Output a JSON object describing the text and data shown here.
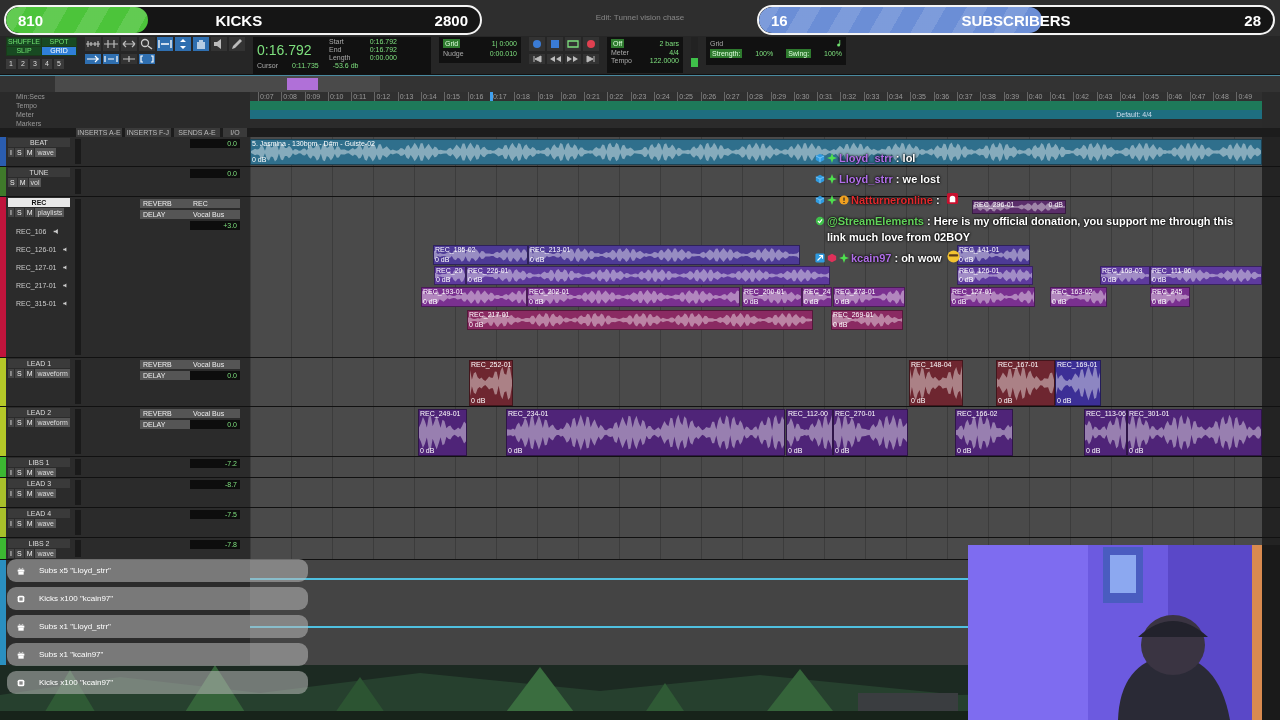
{
  "window": {
    "title": "Edit: Tunnel vision chase"
  },
  "toolbar": {
    "modes": [
      {
        "label": "SHUFFLE",
        "selected": false
      },
      {
        "label": "SPOT",
        "selected": false
      },
      {
        "label": "SLIP",
        "selected": false
      },
      {
        "label": "GRID",
        "selected": true
      }
    ],
    "zoom_presets": [
      "1",
      "2",
      "3",
      "4",
      "5"
    ],
    "counter": {
      "main": "0:16.792",
      "start_label": "Start",
      "start": "0:16.792",
      "end_label": "End",
      "end": "0:16.792",
      "length_label": "Length",
      "length": "0:00.000",
      "cursor_label": "Cursor",
      "cursor": "0:11.735",
      "cursor_value": "-53.6 db"
    },
    "grid": {
      "grid_label": "Grid",
      "grid_value": "1| 0:000",
      "nudge_label": "Nudge",
      "nudge_value": "0:00.010"
    },
    "count": {
      "count_off": "Off",
      "bars": "2 bars",
      "meter_label": "Meter",
      "meter": "4/4",
      "tempo_label": "Tempo",
      "tempo": "122.0000"
    },
    "midi": {
      "grid_label": "Grid",
      "strength_label": "Strength:",
      "strength": "100%",
      "swing_label": "Swing:",
      "swing": "100%"
    }
  },
  "ruler": {
    "rows": [
      "Min:Secs",
      "Tempo",
      "Meter",
      "Markers"
    ],
    "ticks": [
      "0:07",
      "0:08",
      "0:09",
      "0:10",
      "0:11",
      "0:12",
      "0:13",
      "0:14",
      "0:15",
      "0:16",
      "0:17",
      "0:18",
      "0:19",
      "0:20",
      "0:21",
      "0:22",
      "0:23",
      "0:24",
      "0:25",
      "0:26",
      "0:27",
      "0:28",
      "0:29",
      "0:30",
      "0:31",
      "0:32",
      "0:33",
      "0:34",
      "0:35",
      "0:36",
      "0:37",
      "0:38",
      "0:39",
      "0:40",
      "0:41",
      "0:42",
      "0:43",
      "0:44",
      "0:45",
      "0:46",
      "0:47",
      "0:48",
      "0:49"
    ],
    "meter_marker": "Default: 4/4"
  },
  "columns": [
    "INSERTS A-E",
    "INSERTS F-J",
    "SENDS A-E",
    "I/O"
  ],
  "tracks": [
    {
      "name": "BEAT",
      "color": "#2a5db0",
      "kind": "compact",
      "selected": false,
      "buttons": [
        "I",
        "S",
        "M"
      ],
      "view": "wave",
      "volume": "0.0",
      "clips": [
        {
          "name": "5. Jasmina - 130bpm - D#m - Guiste-02",
          "gain": "0 dB",
          "color": "#2f6f8c"
        }
      ]
    },
    {
      "name": "TUNE",
      "color": "#3f7a2a",
      "kind": "compact",
      "selected": false,
      "buttons": [
        "S",
        "M"
      ],
      "view": "vol",
      "volume": "0.0"
    },
    {
      "name": "REC",
      "color": "#c0143c",
      "kind": "playlists",
      "selected": true,
      "buttons": [
        "I",
        "S",
        "M"
      ],
      "view": "playlists",
      "volume": "+3.0",
      "sends": [
        "REVERB",
        "DELAY"
      ],
      "outputs": [
        "REC",
        "Vocal Bus"
      ],
      "playlists": [
        "REC_106",
        "REC_126-01",
        "REC_127-01",
        "REC_217-01",
        "REC_315-01"
      ],
      "clips": [
        {
          "name": "REC_296-01",
          "gain": "0 dB",
          "color": "#5a2d6a"
        },
        {
          "name": "REC_185-02",
          "gain": "0 dB",
          "color": "#4d3a96"
        },
        {
          "name": "REC_213-01",
          "gain": "0 dB",
          "color": "#4d3a96"
        },
        {
          "name": "REC_141-01",
          "gain": "0 dB",
          "color": "#4d3a96"
        },
        {
          "name": "REC_20",
          "gain": "0 dB",
          "color": "#5e3a9e"
        },
        {
          "name": "REC_226-01",
          "gain": "0 dB",
          "color": "#5e3a9e"
        },
        {
          "name": "REC_126-01",
          "gain": "0 dB",
          "color": "#5e3a9e"
        },
        {
          "name": "REC_163-03",
          "gain": "0 dB",
          "color": "#5e3a9e"
        },
        {
          "name": "REC_111-06",
          "gain": "0 dB",
          "color": "#5e3a9e"
        },
        {
          "name": "REC_193-01",
          "gain": "0 dB",
          "color": "#7a3090"
        },
        {
          "name": "REC_202-01",
          "gain": "0 dB",
          "color": "#7a3090"
        },
        {
          "name": "REC_200-01",
          "gain": "0 dB",
          "color": "#7a3090"
        },
        {
          "name": "REC_24",
          "gain": "0 dB",
          "color": "#7a3090"
        },
        {
          "name": "REC_273-01",
          "gain": "0 dB",
          "color": "#7a3090"
        },
        {
          "name": "REC_127-01",
          "gain": "0 dB",
          "color": "#7a3090"
        },
        {
          "name": "REC_163-02",
          "gain": "0 dB",
          "color": "#7a3090"
        },
        {
          "name": "REC_245",
          "gain": "0 dB",
          "color": "#7a3090"
        },
        {
          "name": "REC_217-01",
          "gain": "0 dB",
          "color": "#8a2a62"
        },
        {
          "name": "REC_269-01",
          "gain": "0 dB",
          "color": "#8a2a62"
        }
      ]
    },
    {
      "name": "LEAD 1",
      "color": "#b4c828",
      "kind": "full",
      "selected": false,
      "buttons": [
        "I",
        "S",
        "M"
      ],
      "view": "waveform",
      "volume": "0.0",
      "sends": [
        "REVERB",
        "DELAY"
      ],
      "outputs": [
        "Vocal Bus"
      ],
      "clips": [
        {
          "name": "REC_252-01",
          "gain": "0 dB",
          "color": "#6e2630"
        },
        {
          "name": "REC_148-04",
          "gain": "0 dB",
          "color": "#6e2630"
        },
        {
          "name": "REC_167-01",
          "gain": "0 dB",
          "color": "#6e2630"
        },
        {
          "name": "REC_169-01",
          "gain": "0 dB",
          "color": "#3c2f96"
        }
      ]
    },
    {
      "name": "LEAD 2",
      "color": "#b4c828",
      "kind": "full",
      "selected": false,
      "buttons": [
        "I",
        "S",
        "M"
      ],
      "view": "waveform",
      "volume": "0.0",
      "sends": [
        "REVERB",
        "DELAY"
      ],
      "outputs": [
        "Vocal Bus"
      ],
      "clips": [
        {
          "name": "REC_249-01",
          "gain": "0 dB",
          "color": "#4f2478"
        },
        {
          "name": "REC_234-01",
          "gain": "0 dB",
          "color": "#4f2478"
        },
        {
          "name": "REC_112-00",
          "gain": "0 dB",
          "color": "#4f2478"
        },
        {
          "name": "REC_270-01",
          "gain": "0 dB",
          "color": "#4f2478"
        },
        {
          "name": "REC_166-02",
          "gain": "0 dB",
          "color": "#4f2478"
        },
        {
          "name": "REC_113-06",
          "gain": "0 dB",
          "color": "#4f2478"
        },
        {
          "name": "REC_301-01",
          "gain": "0 dB",
          "color": "#4f2478"
        }
      ]
    },
    {
      "name": "LIBS 1",
      "color": "#3cb832",
      "kind": "compact",
      "selected": false,
      "buttons": [
        "I",
        "S",
        "M"
      ],
      "view": "wave",
      "volume": "-7.2"
    },
    {
      "name": "LEAD 3",
      "color": "#a8c02a",
      "kind": "compact",
      "selected": false,
      "buttons": [
        "I",
        "S",
        "M"
      ],
      "view": "wave",
      "volume": "-8.7"
    },
    {
      "name": "LEAD 4",
      "color": "#a8c02a",
      "kind": "compact",
      "selected": false,
      "buttons": [
        "I",
        "S",
        "M"
      ],
      "view": "wave",
      "volume": "-7.5"
    },
    {
      "name": "LIBS 2",
      "color": "#3cb832",
      "kind": "compact",
      "selected": false,
      "buttons": [
        "I",
        "S",
        "M"
      ],
      "view": "wave",
      "volume": "-7.8"
    }
  ],
  "goals": [
    {
      "current": "810",
      "label": "KICKS",
      "target": "2800",
      "level": 0.3,
      "color": "#4cc43a"
    },
    {
      "current": "16",
      "label": "SUBSCRIBERS",
      "target": "28",
      "level": 0.55,
      "color": "#6b8ed6"
    }
  ],
  "chat": [
    {
      "user": "Lloyd_strr",
      "text": ": lol",
      "color": "#b06ee8"
    },
    {
      "user": "Lloyd_strr",
      "text": ": we lost",
      "color": "#b06ee8"
    },
    {
      "user": "Natturneronline",
      "text": ":",
      "color": "#e0282c"
    },
    {
      "user": "@StreamElements",
      "text": ": Here is my official donation, you support me through this link much love from 02BOY",
      "color": "#62d25a"
    },
    {
      "user": "kcain97",
      "text": ": oh wow",
      "color": "#b06ee8"
    }
  ],
  "alerts": [
    {
      "kind": "gift",
      "text": "Subs x5 \"Lloyd_strr\""
    },
    {
      "kind": "kick",
      "text": "Kicks x100 \"kcain97\""
    },
    {
      "kind": "gift",
      "text": "Subs x1 \"Lloyd_strr\""
    },
    {
      "kind": "gift",
      "text": "Subs x1 \"kcain97\""
    },
    {
      "kind": "kick",
      "text": "Kicks x100 \"kcain97\""
    }
  ]
}
